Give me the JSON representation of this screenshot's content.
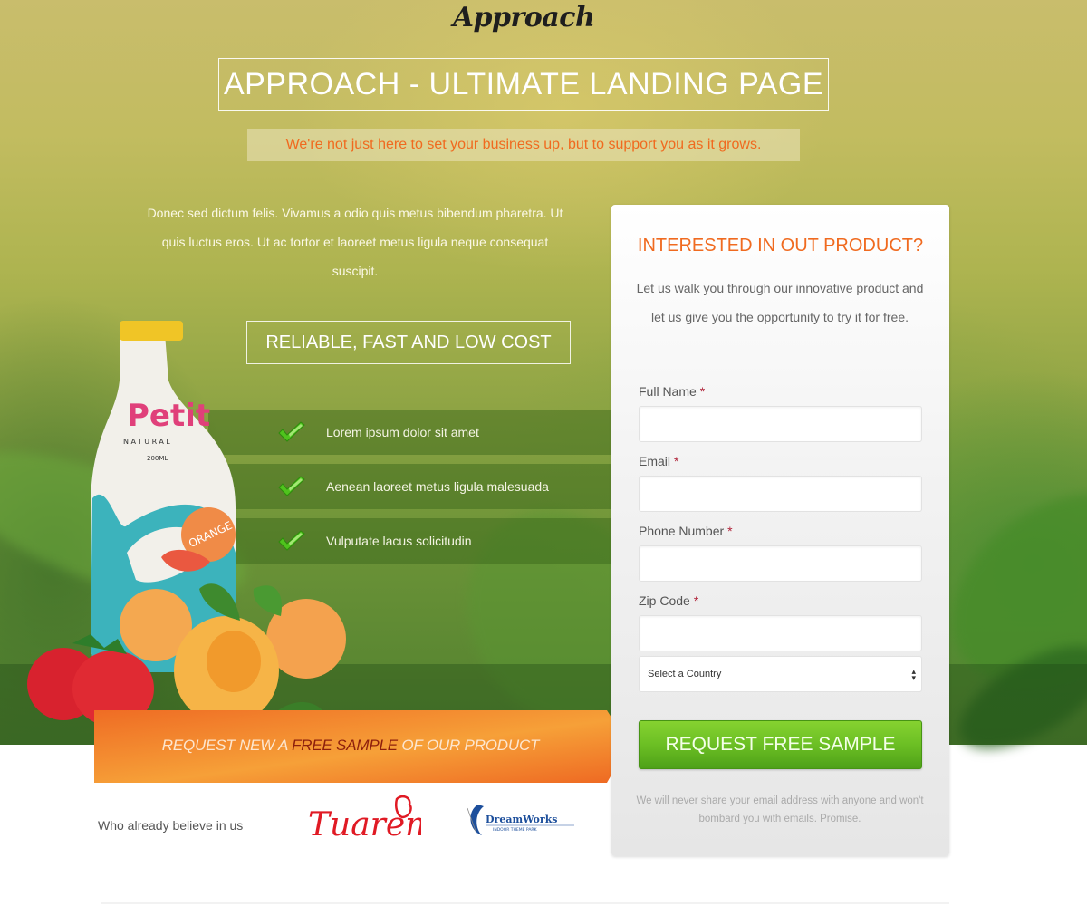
{
  "brand": {
    "logo_text": "Approach"
  },
  "hero": {
    "title": "APPROACH - ULTIMATE LANDING PAGE",
    "tagline": "We're not just here to set your business up, but to support you as it grows.",
    "intro": "Donec sed dictum felis. Vivamus a odio quis metus bibendum pharetra. Ut quis luctus eros. Ut ac tortor et laoreet metus ligula neque consequat suscipit.",
    "features_title": "RELIABLE, FAST AND LOW COST",
    "features": [
      {
        "icon": "check-icon",
        "text": "Lorem ipsum dolor sit amet"
      },
      {
        "icon": "check-icon",
        "text": "Aenean laoreet metus ligula malesuada"
      },
      {
        "icon": "check-icon",
        "text": "Vulputate lacus solicitudin"
      }
    ],
    "product_image": {
      "brand": "Petit",
      "subtitle": "NATURAL",
      "volume": "200ML",
      "flavor": "ORANGE"
    }
  },
  "cta_banner": {
    "prefix": "REQUEST NEW A ",
    "highlight": "FREE SAMPLE",
    "suffix": " OF OUR PRODUCT"
  },
  "clients": {
    "label": "Who already believe in us",
    "logos": [
      {
        "name": "Tuaren"
      },
      {
        "name": "DreamWorks",
        "sub": "INDOOR THEME PARK"
      }
    ]
  },
  "form": {
    "title": "INTERESTED IN OUT PRODUCT?",
    "description": "Let us walk you through our innovative product and let us give you the opportunity to try it for free.",
    "fields": [
      {
        "label": "Full Name",
        "required_mark": "*",
        "value": "",
        "placeholder": ""
      },
      {
        "label": "Email",
        "required_mark": "*",
        "value": "",
        "placeholder": ""
      },
      {
        "label": "Phone Number",
        "required_mark": "*",
        "value": "",
        "placeholder": ""
      },
      {
        "label": "Zip Code",
        "required_mark": "*",
        "value": "",
        "placeholder": ""
      }
    ],
    "country_select": {
      "selected": "Select a Country"
    },
    "submit_label": "REQUEST FREE SAMPLE",
    "privacy_note": "We will never share your email address with anyone and won't bombard you with emails. Promise."
  },
  "colors": {
    "accent_orange": "#f06a1f",
    "button_green": "#6cbf24",
    "required_red": "#b0243a",
    "highlight_dark_red": "#8e1f0c"
  }
}
